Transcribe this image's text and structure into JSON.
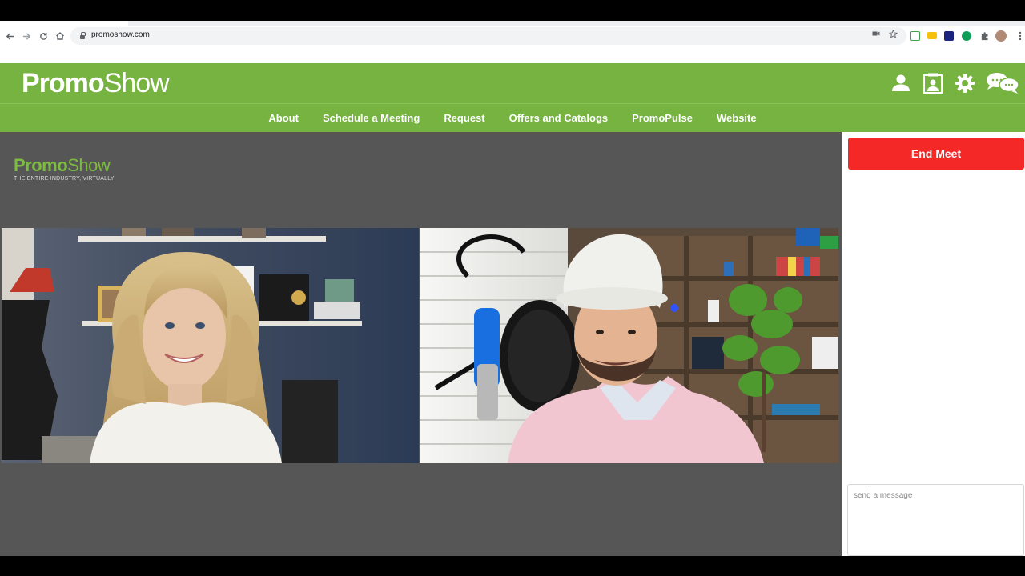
{
  "browser": {
    "url": "promoshow.com"
  },
  "header": {
    "brand_bold": "Promo",
    "brand_light": "Show",
    "brand_color": "#77b340"
  },
  "nav": {
    "items": [
      "About",
      "Schedule a Meeting",
      "Request",
      "Offers and Catalogs",
      "PromoPulse",
      "Website"
    ]
  },
  "stage": {
    "logo_bold": "Promo",
    "logo_light": "Show",
    "tagline": "THE ENTIRE INDUSTRY, VIRTUALLY"
  },
  "side": {
    "end_button": "End Meet",
    "end_color": "#f52828",
    "message_placeholder": "send a message"
  },
  "icons": [
    "back-icon",
    "forward-icon",
    "reload-icon",
    "home-icon",
    "lock-icon",
    "camera-icon",
    "star-icon",
    "profile-icon",
    "contact-card-icon",
    "gear-icon",
    "chat-icon"
  ]
}
